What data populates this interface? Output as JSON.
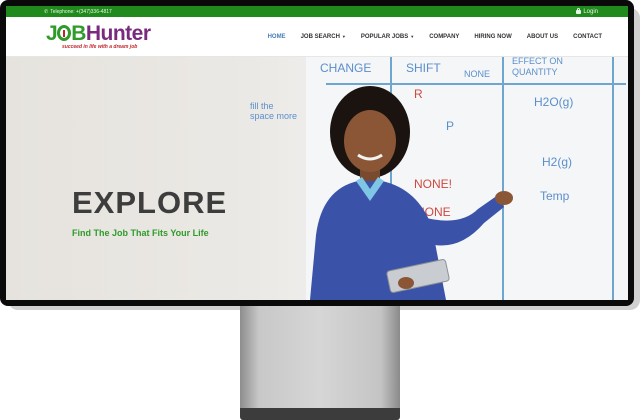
{
  "topbar": {
    "phone": "Telephone: +(347)336-4817",
    "login": "Login"
  },
  "logo": {
    "part1": "J",
    "part2": "B",
    "part3": "Hunter",
    "tagline": "succeed in life with a dream job"
  },
  "nav": {
    "items": [
      {
        "label": "HOME",
        "active": true
      },
      {
        "label": "JOB SEARCH",
        "dropdown": true
      },
      {
        "label": "POPULAR JOBS",
        "dropdown": true
      },
      {
        "label": "COMPANY"
      },
      {
        "label": "HIRING NOW"
      },
      {
        "label": "ABOUT US"
      },
      {
        "label": "CONTACT"
      }
    ]
  },
  "hero": {
    "title": "EXPLORE",
    "subtitle": "Find The Job That Fits Your Life"
  },
  "whiteboard": {
    "headers": [
      "CHANGE",
      "SHIFT",
      "EFFECT ON QUANTITY"
    ],
    "notes": [
      "fill the space more",
      "NONE",
      "R",
      "P",
      "H2O(g)",
      "H2(g)",
      "NONE!",
      "Temp",
      "NONE"
    ]
  },
  "colors": {
    "topbar": "#208a1c",
    "accent_green": "#2f9b2a",
    "accent_red": "#c0242a",
    "nav_active": "#4a7fb8"
  }
}
